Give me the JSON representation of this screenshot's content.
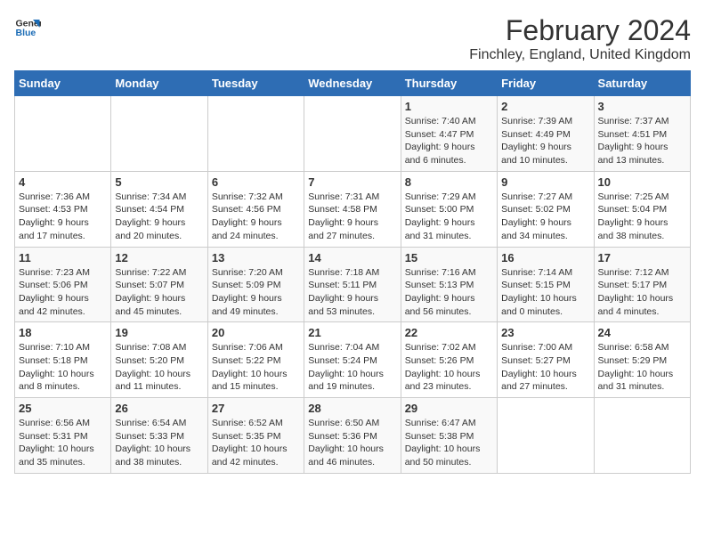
{
  "logo": {
    "line1": "General",
    "line2": "Blue"
  },
  "title": "February 2024",
  "subtitle": "Finchley, England, United Kingdom",
  "days_header": [
    "Sunday",
    "Monday",
    "Tuesday",
    "Wednesday",
    "Thursday",
    "Friday",
    "Saturday"
  ],
  "weeks": [
    [
      {
        "day": "",
        "info": ""
      },
      {
        "day": "",
        "info": ""
      },
      {
        "day": "",
        "info": ""
      },
      {
        "day": "",
        "info": ""
      },
      {
        "day": "1",
        "info": "Sunrise: 7:40 AM\nSunset: 4:47 PM\nDaylight: 9 hours\nand 6 minutes."
      },
      {
        "day": "2",
        "info": "Sunrise: 7:39 AM\nSunset: 4:49 PM\nDaylight: 9 hours\nand 10 minutes."
      },
      {
        "day": "3",
        "info": "Sunrise: 7:37 AM\nSunset: 4:51 PM\nDaylight: 9 hours\nand 13 minutes."
      }
    ],
    [
      {
        "day": "4",
        "info": "Sunrise: 7:36 AM\nSunset: 4:53 PM\nDaylight: 9 hours\nand 17 minutes."
      },
      {
        "day": "5",
        "info": "Sunrise: 7:34 AM\nSunset: 4:54 PM\nDaylight: 9 hours\nand 20 minutes."
      },
      {
        "day": "6",
        "info": "Sunrise: 7:32 AM\nSunset: 4:56 PM\nDaylight: 9 hours\nand 24 minutes."
      },
      {
        "day": "7",
        "info": "Sunrise: 7:31 AM\nSunset: 4:58 PM\nDaylight: 9 hours\nand 27 minutes."
      },
      {
        "day": "8",
        "info": "Sunrise: 7:29 AM\nSunset: 5:00 PM\nDaylight: 9 hours\nand 31 minutes."
      },
      {
        "day": "9",
        "info": "Sunrise: 7:27 AM\nSunset: 5:02 PM\nDaylight: 9 hours\nand 34 minutes."
      },
      {
        "day": "10",
        "info": "Sunrise: 7:25 AM\nSunset: 5:04 PM\nDaylight: 9 hours\nand 38 minutes."
      }
    ],
    [
      {
        "day": "11",
        "info": "Sunrise: 7:23 AM\nSunset: 5:06 PM\nDaylight: 9 hours\nand 42 minutes."
      },
      {
        "day": "12",
        "info": "Sunrise: 7:22 AM\nSunset: 5:07 PM\nDaylight: 9 hours\nand 45 minutes."
      },
      {
        "day": "13",
        "info": "Sunrise: 7:20 AM\nSunset: 5:09 PM\nDaylight: 9 hours\nand 49 minutes."
      },
      {
        "day": "14",
        "info": "Sunrise: 7:18 AM\nSunset: 5:11 PM\nDaylight: 9 hours\nand 53 minutes."
      },
      {
        "day": "15",
        "info": "Sunrise: 7:16 AM\nSunset: 5:13 PM\nDaylight: 9 hours\nand 56 minutes."
      },
      {
        "day": "16",
        "info": "Sunrise: 7:14 AM\nSunset: 5:15 PM\nDaylight: 10 hours\nand 0 minutes."
      },
      {
        "day": "17",
        "info": "Sunrise: 7:12 AM\nSunset: 5:17 PM\nDaylight: 10 hours\nand 4 minutes."
      }
    ],
    [
      {
        "day": "18",
        "info": "Sunrise: 7:10 AM\nSunset: 5:18 PM\nDaylight: 10 hours\nand 8 minutes."
      },
      {
        "day": "19",
        "info": "Sunrise: 7:08 AM\nSunset: 5:20 PM\nDaylight: 10 hours\nand 11 minutes."
      },
      {
        "day": "20",
        "info": "Sunrise: 7:06 AM\nSunset: 5:22 PM\nDaylight: 10 hours\nand 15 minutes."
      },
      {
        "day": "21",
        "info": "Sunrise: 7:04 AM\nSunset: 5:24 PM\nDaylight: 10 hours\nand 19 minutes."
      },
      {
        "day": "22",
        "info": "Sunrise: 7:02 AM\nSunset: 5:26 PM\nDaylight: 10 hours\nand 23 minutes."
      },
      {
        "day": "23",
        "info": "Sunrise: 7:00 AM\nSunset: 5:27 PM\nDaylight: 10 hours\nand 27 minutes."
      },
      {
        "day": "24",
        "info": "Sunrise: 6:58 AM\nSunset: 5:29 PM\nDaylight: 10 hours\nand 31 minutes."
      }
    ],
    [
      {
        "day": "25",
        "info": "Sunrise: 6:56 AM\nSunset: 5:31 PM\nDaylight: 10 hours\nand 35 minutes."
      },
      {
        "day": "26",
        "info": "Sunrise: 6:54 AM\nSunset: 5:33 PM\nDaylight: 10 hours\nand 38 minutes."
      },
      {
        "day": "27",
        "info": "Sunrise: 6:52 AM\nSunset: 5:35 PM\nDaylight: 10 hours\nand 42 minutes."
      },
      {
        "day": "28",
        "info": "Sunrise: 6:50 AM\nSunset: 5:36 PM\nDaylight: 10 hours\nand 46 minutes."
      },
      {
        "day": "29",
        "info": "Sunrise: 6:47 AM\nSunset: 5:38 PM\nDaylight: 10 hours\nand 50 minutes."
      },
      {
        "day": "",
        "info": ""
      },
      {
        "day": "",
        "info": ""
      }
    ]
  ]
}
